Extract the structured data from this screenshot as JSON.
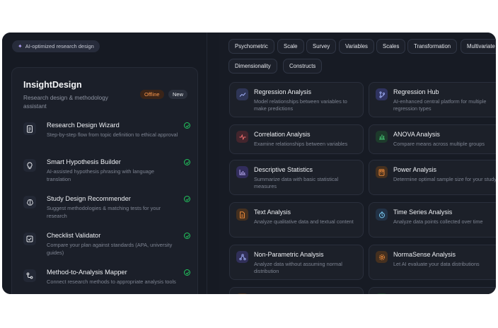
{
  "left": {
    "ai_chip": "AI-optimized research design",
    "card": {
      "title": "InsightDesign",
      "subtitle": "Research design & methodology assistant",
      "badge_offline": "Offline",
      "badge_new": "New",
      "tools": [
        {
          "name": "Research Design Wizard",
          "desc": "Step-by-step flow from topic definition to ethical approval",
          "icon": "document-icon"
        },
        {
          "name": "Smart Hypothesis Builder",
          "desc": "AI-assisted hypothesis phrasing with language translation",
          "icon": "lightbulb-icon"
        },
        {
          "name": "Study Design Recommender",
          "desc": "Suggest methodologies & matching tests for your research",
          "icon": "brain-icon"
        },
        {
          "name": "Checklist Validator",
          "desc": "Compare your plan against standards (APA, university guides)",
          "icon": "checkbox-icon"
        },
        {
          "name": "Method-to-Analysis Mapper",
          "desc": "Connect research methods to appropriate analysis tools",
          "icon": "route-icon"
        }
      ]
    }
  },
  "right": {
    "chips": [
      "Psychometric",
      "Scale",
      "Survey",
      "Variables",
      "Scales",
      "Transformation",
      "Multivariate",
      "Dimensionality",
      "Constructs"
    ],
    "tiles": [
      {
        "name": "Regression Analysis",
        "desc": "Model relationships between variables to make predictions",
        "icon": "trend-icon",
        "color": "#3b4470"
      },
      {
        "name": "Regression Hub",
        "desc": "AI-enhanced central platform for multiple regression types",
        "icon": "branch-icon",
        "color": "#3b3f75"
      },
      {
        "name": "Correlation Analysis",
        "desc": "Examine relationships between variables",
        "icon": "pulse-icon",
        "color": "#4a2a33"
      },
      {
        "name": "ANOVA Analysis",
        "desc": "Compare means across multiple groups",
        "icon": "bars-icon",
        "color": "#1f3b2d"
      },
      {
        "name": "Descriptive Statistics",
        "desc": "Summarize data with basic statistical measures",
        "icon": "chart-icon",
        "color": "#3a3466"
      },
      {
        "name": "Power Analysis",
        "desc": "Determine optimal sample size for your study",
        "icon": "calculator-icon",
        "color": "#4a3222"
      },
      {
        "name": "Text Analysis",
        "desc": "Analyze qualitative data and textual content",
        "icon": "text-file-icon",
        "color": "#4a3222"
      },
      {
        "name": "Time Series Analysis",
        "desc": "Analyze data points collected over time",
        "icon": "clock-icon",
        "color": "#233347"
      },
      {
        "name": "Non-Parametric Analysis",
        "desc": "Analyze data without assuming normal distribution",
        "icon": "nodes-icon",
        "color": "#34355e"
      },
      {
        "name": "NormaSense Analysis",
        "desc": "Let AI evaluate your data distributions",
        "icon": "gear-icon",
        "color": "#4a3222"
      }
    ]
  }
}
